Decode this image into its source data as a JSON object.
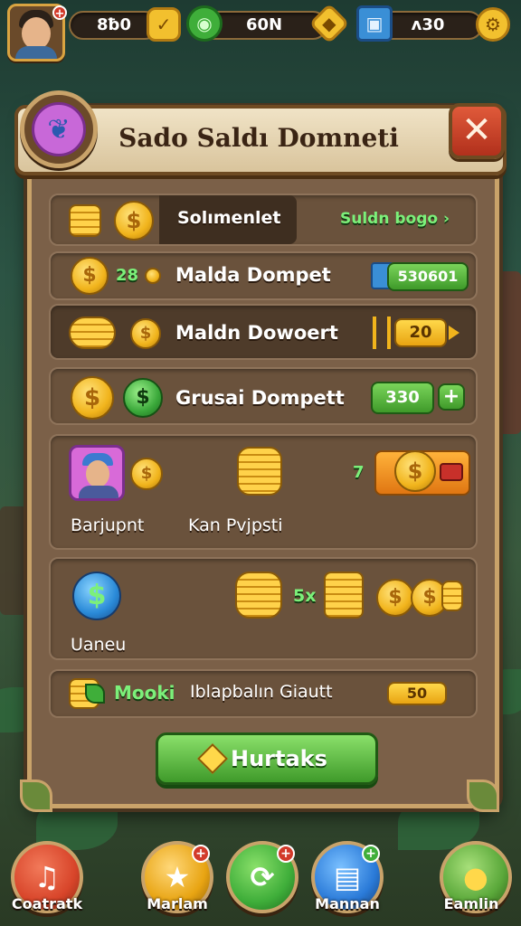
{
  "topbar": {
    "resource_1": "8ƀ0",
    "resource_2": "60N",
    "resource_3": "ʌ30",
    "avatar_badge": "+"
  },
  "panel": {
    "title": "Sado Saldı Domneti",
    "close_glyph": "✕"
  },
  "rows": {
    "r1": {
      "label": "Solımenlet",
      "link": "Suldn bogo ›"
    },
    "r2": {
      "count": "28",
      "label": "Malda Dompet",
      "value": "530601"
    },
    "r3": {
      "label": "Maldn Dowoert",
      "value": "20"
    },
    "r4": {
      "label": "Grusai Dompett",
      "value": "330",
      "plus": "+"
    },
    "r5": {
      "label_left": "Barjupnt",
      "label_mid": "Kan Pvjpsti",
      "number": "7"
    },
    "r6": {
      "label": "Uaneu",
      "multiplier": "5x"
    },
    "r7": {
      "tag": "Mooki",
      "label": "Iblapbalın Giautt",
      "value": "50"
    }
  },
  "cta": {
    "label": "Hurtaks"
  },
  "nav": [
    {
      "label": "Coatratk",
      "icon": "music-note-icon",
      "color": "#d8452a"
    },
    {
      "label": "Marlam",
      "icon": "star-icon",
      "color": "#e8a412",
      "badge": "+"
    },
    {
      "label": "",
      "icon": "refresh-icon",
      "color": "#3fae3a",
      "badge": "+"
    },
    {
      "label": "Mannan",
      "icon": "ticket-icon",
      "color": "#2a7ad8",
      "badge": "+"
    },
    {
      "label": "Eamlin",
      "icon": "lemon-icon",
      "color": "#5aa83a"
    }
  ],
  "colors": {
    "panel_bg": "#7b6048",
    "panel_border": "#c9a36a",
    "accent_green": "#3f9a2a",
    "accent_gold": "#f1b41c",
    "close_red": "#b1301c"
  }
}
